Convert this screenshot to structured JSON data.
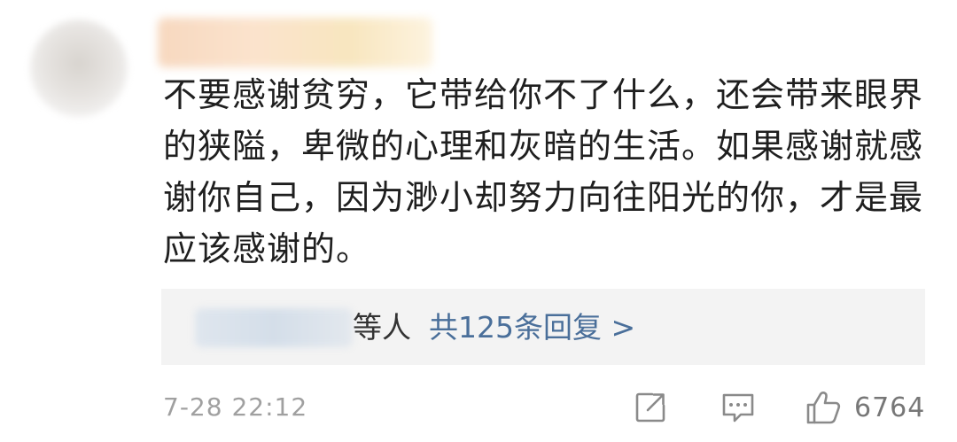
{
  "comment": {
    "text": "不要感谢贫穷，它带给你不了什么，还会带来眼界的狭隘，卑微的心理和灰暗的生活。如果感谢就感谢你自己，因为渺小却努力向往阳光的你，才是最应该感谢的。",
    "replies": {
      "others_label": "等人",
      "count_label": "共125条回复 >"
    },
    "timestamp": "7-28 22:12",
    "like_count": "6764"
  },
  "colors": {
    "reply_link": "#4a6f9a",
    "meta_gray": "#a0a0a0",
    "reply_box_bg": "#f3f3f3"
  },
  "icons": [
    "share-icon",
    "comment-icon",
    "thumbs-up-icon"
  ]
}
